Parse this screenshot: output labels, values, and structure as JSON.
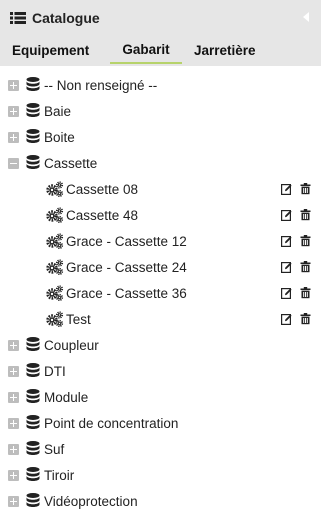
{
  "panel": {
    "title": "Catalogue",
    "tabs": [
      "Equipement",
      "Gabarit",
      "Jarretière"
    ],
    "active_tab": "Gabarit"
  },
  "tree": {
    "items": [
      {
        "label": "-- Non renseigné --",
        "expanded": false
      },
      {
        "label": "Baie",
        "expanded": false
      },
      {
        "label": "Boite",
        "expanded": false
      },
      {
        "label": "Cassette",
        "expanded": true,
        "children": [
          "Cassette 08",
          "Cassette 48",
          "Grace - Cassette 12",
          "Grace - Cassette 24",
          "Grace - Cassette 36",
          "Test"
        ]
      },
      {
        "label": "Coupleur",
        "expanded": false
      },
      {
        "label": "DTI",
        "expanded": false
      },
      {
        "label": "Module",
        "expanded": false
      },
      {
        "label": "Point de concentration",
        "expanded": false
      },
      {
        "label": "Suf",
        "expanded": false
      },
      {
        "label": "Tiroir",
        "expanded": false
      },
      {
        "label": "Vidéoprotection",
        "expanded": false
      }
    ]
  },
  "icons": {
    "header": "list-icon",
    "category": "database-icon",
    "template": "gears-icon",
    "edit": "edit-icon",
    "delete": "trash-icon",
    "collapse": "chevron-left-icon"
  },
  "colors": {
    "header_bg": "#e6e6e6",
    "active_tab_underline": "#b7d36b",
    "toggle": "#bdbdbd"
  }
}
